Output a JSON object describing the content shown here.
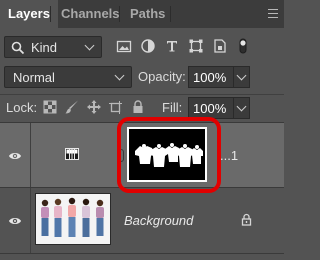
{
  "tabs": [
    {
      "label": "Layers",
      "active": true
    },
    {
      "label": "Channels",
      "active": false
    },
    {
      "label": "Paths",
      "active": false
    }
  ],
  "filter": {
    "kind_label": "Kind",
    "icons": [
      "pixel-filter-icon",
      "adjustment-filter-icon",
      "type-filter-icon",
      "shape-filter-icon",
      "smart-object-filter-icon",
      "filter-toggle-icon"
    ]
  },
  "blend": {
    "mode": "Normal",
    "opacity_label": "Opacity:",
    "opacity_value": "100%"
  },
  "lock": {
    "label": "Lock:",
    "icons": [
      "lock-transparent-icon",
      "lock-image-icon",
      "lock-position-icon",
      "lock-artboard-icon",
      "lock-all-icon"
    ],
    "fill_label": "Fill:",
    "fill_value": "100%"
  },
  "layers": [
    {
      "name_visible": "...1",
      "type": "adjustment",
      "selected": true,
      "visible": true
    },
    {
      "name_visible": "Background",
      "type": "image",
      "selected": false,
      "visible": true,
      "locked": true
    }
  ],
  "colors": {
    "panel": "#535353",
    "tabbar": "#3c3c3c",
    "selected_layer": "#6a6a6a",
    "highlight": "#e10000"
  }
}
